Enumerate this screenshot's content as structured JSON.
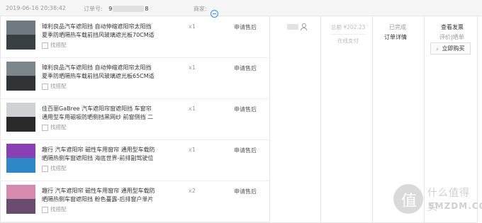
{
  "header": {
    "datetime": "2019-06-16 20:38:42",
    "order_label": "订单号:",
    "order_prefix": "9",
    "order_suffix": "8",
    "seller_label": "商家:"
  },
  "items": [
    {
      "name": "璋利良品汽车遮阳挡 自动伸缩遮阳帘太阳挡 夏季防晒隔热车载前挡风玻璃遮光板70CM适",
      "match": "找搭配",
      "qty": "x1",
      "after": "申请售后",
      "thumb_colors": [
        "#6f7a80",
        "#3a3f44"
      ]
    },
    {
      "name": "璋利良品汽车遮阳挡 自动伸缩遮阳帘太阳挡 夏季防晒隔热车载前挡风玻璃遮光板65CM适",
      "match": "找搭配",
      "qty": "x1",
      "after": "申请售后",
      "thumb_colors": [
        "#7d868b",
        "#2f3336"
      ]
    },
    {
      "name": "佳百丽GaBree 汽车遮阳帘窗遮阳挡 车窗帘通用型车用磁吸防晒侧挡黑网纱 前窗侧挡 二片",
      "match": "找搭配",
      "qty": "x1",
      "after": "申请售后",
      "thumb_colors": [
        "#cfd2d3",
        "#2a2a2a"
      ]
    },
    {
      "name": "趣行 汽车遮阳帘 磁性车用窗帘 通用型车载防晒隔热侧车窗遮阳挡 海底世界-前排副驾驶位",
      "match": "找搭配",
      "qty": "x1",
      "after": "申请售后",
      "thumb_colors": [
        "#8a3fb5",
        "#2e88c7"
      ]
    },
    {
      "name": "趣行 汽车遮阳帘 磁性车用窗帘 通用型车载防晒隔热侧车窗遮阳挡 粉色蔓露-后排窗户单片",
      "match": "找搭配",
      "qty": "x2",
      "after": "申请售后",
      "thumb_colors": [
        "#d58ab0",
        "#6a4c6e"
      ]
    }
  ],
  "total": "总额 ¥202.23",
  "payment": "在线支付",
  "status": "已完成",
  "order_detail": "订单详情",
  "invoice": "查看发票",
  "review": "评价|晒单",
  "buy_again": "立即购买",
  "watermark": {
    "text1": "什么值得买",
    "text2": "SMZDM.COM",
    "logo_char": "值"
  }
}
